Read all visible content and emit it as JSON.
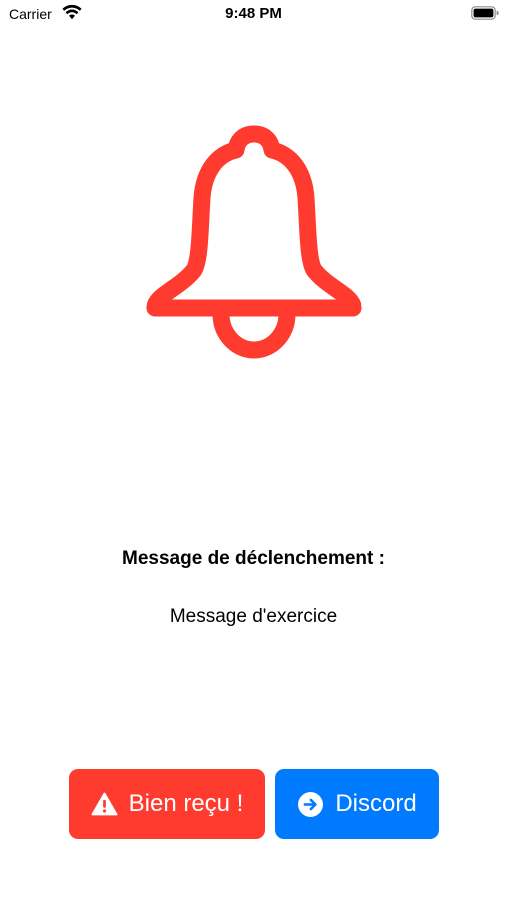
{
  "status_bar": {
    "carrier": "Carrier",
    "time": "9:48 PM",
    "icons": [
      "wifi-icon",
      "battery-icon"
    ]
  },
  "bell": {
    "icon": "bell-icon",
    "color": "#ff3b30"
  },
  "trigger": {
    "title": "Message de déclenchement :",
    "message": "Message d'exercice"
  },
  "actions": {
    "acknowledge": {
      "label": "Bien reçu !",
      "icon": "warning-icon",
      "color": "#ff3b30"
    },
    "discord": {
      "label": "Discord",
      "icon": "arrow-right-circle-icon",
      "color": "#007aff"
    }
  }
}
